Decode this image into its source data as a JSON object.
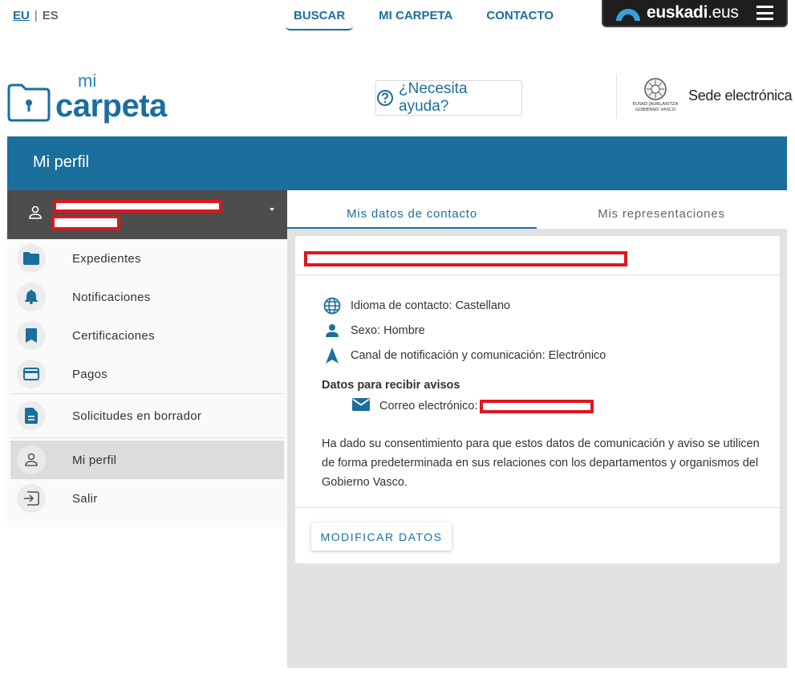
{
  "lang": {
    "eu": "EU",
    "sep": "|",
    "es": "ES"
  },
  "topnav": {
    "buscar": "BUSCAR",
    "micarpeta": "MI CARPETA",
    "contacto": "CONTACTO"
  },
  "euskadi": {
    "brand": "euskadi",
    "tld": ".eus"
  },
  "logo": {
    "mi": "mi",
    "carpeta": "carpeta"
  },
  "help": {
    "label": "¿Necesita ayuda?"
  },
  "sede": {
    "label": "Sede electrónica",
    "seal_line1": "EUSKO JAURLARITZA",
    "seal_line2": "GOBIERNO VASCO"
  },
  "banner": {
    "title": "Mi perfil"
  },
  "sidebar": {
    "items": [
      {
        "label": "Expedientes",
        "icon": "folder-icon"
      },
      {
        "label": "Notificaciones",
        "icon": "bell-icon"
      },
      {
        "label": "Certificaciones",
        "icon": "bookmark-icon"
      },
      {
        "label": "Pagos",
        "icon": "credit-card-icon"
      },
      {
        "label": "Solicitudes en borrador",
        "icon": "document-icon"
      },
      {
        "label": "Mi perfil",
        "icon": "person-icon"
      },
      {
        "label": "Salir",
        "icon": "logout-icon"
      }
    ]
  },
  "tabs": {
    "contact": "Mis datos de contacto",
    "representations": "Mis representaciones"
  },
  "card": {
    "idioma": "Idioma de contacto: Castellano",
    "sexo": "Sexo: Hombre",
    "canal": "Canal de notificación y comunicación: Electrónico",
    "avisos_title": "Datos para recibir avisos",
    "email_label": "Correo electrónico:",
    "consent": "Ha dado su consentimiento para que estos datos de comunicación y aviso se utilicen de forma predeterminada en sus relaciones con los departamentos y organismos del Gobierno Vasco.",
    "modify_button": "MODIFICAR DATOS"
  },
  "colors": {
    "accent": "#1a6f9c",
    "user_box": "#4d4d4d",
    "redaction": "#e0161e",
    "main_bg": "#e2e2e2"
  }
}
